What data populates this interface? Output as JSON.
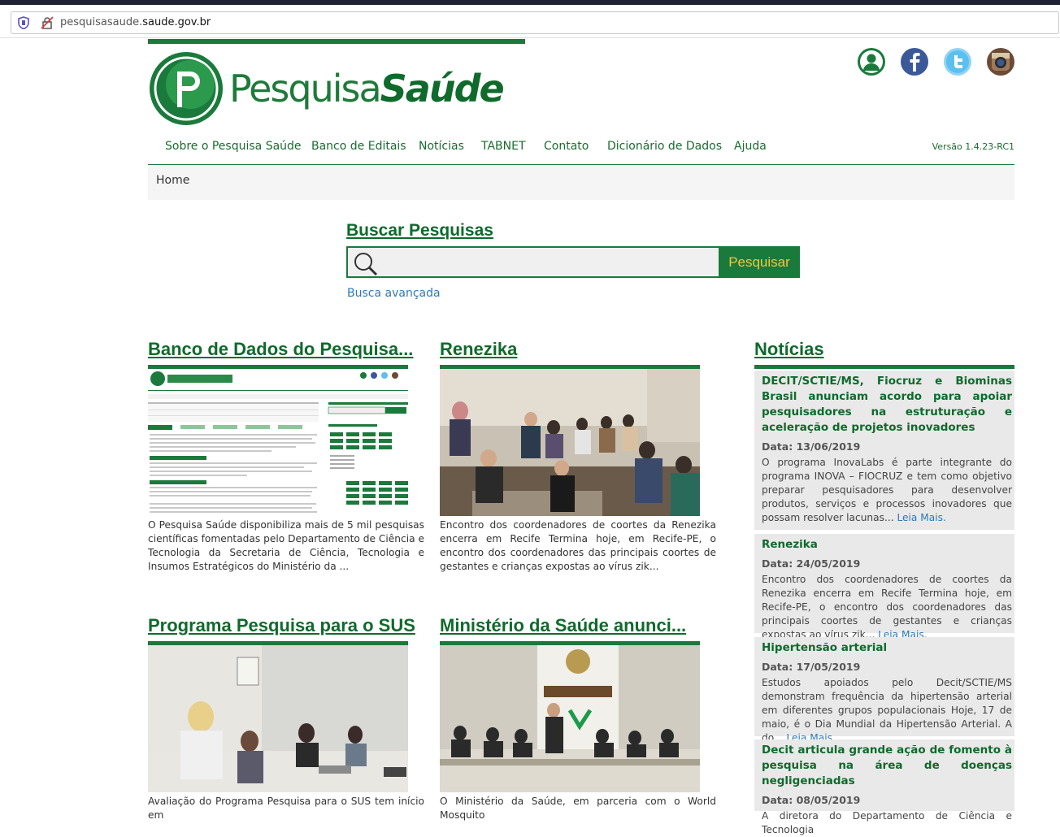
{
  "browser": {
    "url_prefix": "pesquisasaude.",
    "url_domain": "saude.gov.br"
  },
  "header": {
    "logo_text_regular": "Pesquisa",
    "logo_text_bold": "Saúde",
    "social": [
      "user-icon",
      "facebook-icon",
      "twitter-icon",
      "instagram-icon"
    ]
  },
  "nav": {
    "items": [
      {
        "label": "Sobre o Pesquisa Saúde"
      },
      {
        "label": "Banco de Editais"
      },
      {
        "label": "Notícias"
      },
      {
        "label": "TABNET"
      },
      {
        "label": "Contato"
      },
      {
        "label": "Dicionário de Dados"
      },
      {
        "label": "Ajuda"
      }
    ],
    "version": "Versão 1.4.23-RC1"
  },
  "breadcrumb": {
    "home": "Home"
  },
  "search": {
    "title": "Buscar Pesquisas",
    "value": "",
    "button": "Pesquisar",
    "advanced": "Busca avançada"
  },
  "cards": [
    {
      "title": "Banco de Dados do Pesquisa...",
      "text": "O Pesquisa Saúde disponibiliza mais de 5 mil pesquisas científicas fomentadas pelo Departamento de Ciência e Tecnologia da Secretaria de Ciência, Tecnologia e Insumos Estratégicos do Ministério da ..."
    },
    {
      "title": "Renezika",
      "text": "Encontro dos coordenadores de coortes da Renezika encerra em Recife Termina hoje, em Recife-PE, o encontro dos coordenadores das principais coortes de gestantes e crianças expostas ao vírus zik..."
    },
    {
      "title": "Programa Pesquisa para o SUS",
      "text": "Avaliação do Programa Pesquisa para o SUS tem início em"
    },
    {
      "title": "Ministério da Saúde anunci...",
      "text": "O Ministério da Saúde, em parceria com o World Mosquito"
    }
  ],
  "news": {
    "title": "Notícias",
    "read_more": "Leia Mais.",
    "items": [
      {
        "title": "DECIT/SCTIE/MS, Fiocruz e Biominas Brasil anunciam acordo para apoiar pesquisadores na estruturação e aceleração de projetos inovadores",
        "date": "Data: 13/06/2019",
        "text": "O programa InovaLabs é parte integrante do programa INOVA – FIOCRUZ e tem como objetivo preparar pesquisadores para desenvolver produtos, serviços e processos inovadores que possam resolver lacunas..."
      },
      {
        "title": "Renezika",
        "date": "Data: 24/05/2019",
        "text": "Encontro dos coordenadores de coortes da Renezika encerra em Recife Termina hoje, em Recife-PE, o encontro dos coordenadores das principais coortes de gestantes e crianças expostas ao vírus zik..."
      },
      {
        "title": "Hipertensão arterial",
        "date": "Data: 17/05/2019",
        "text": "Estudos apoiados pelo Decit/SCTIE/MS demonstram frequência da hipertensão arterial em diferentes grupos populacionais     Hoje, 17 de maio, é o Dia Mundial da Hipertensão Arterial. A do..."
      },
      {
        "title": "Decit articula grande ação de fomento à pesquisa na área de doenças negligenciadas",
        "date": "Data: 08/05/2019",
        "text": "A diretora do Departamento de Ciência e Tecnologia"
      }
    ]
  }
}
